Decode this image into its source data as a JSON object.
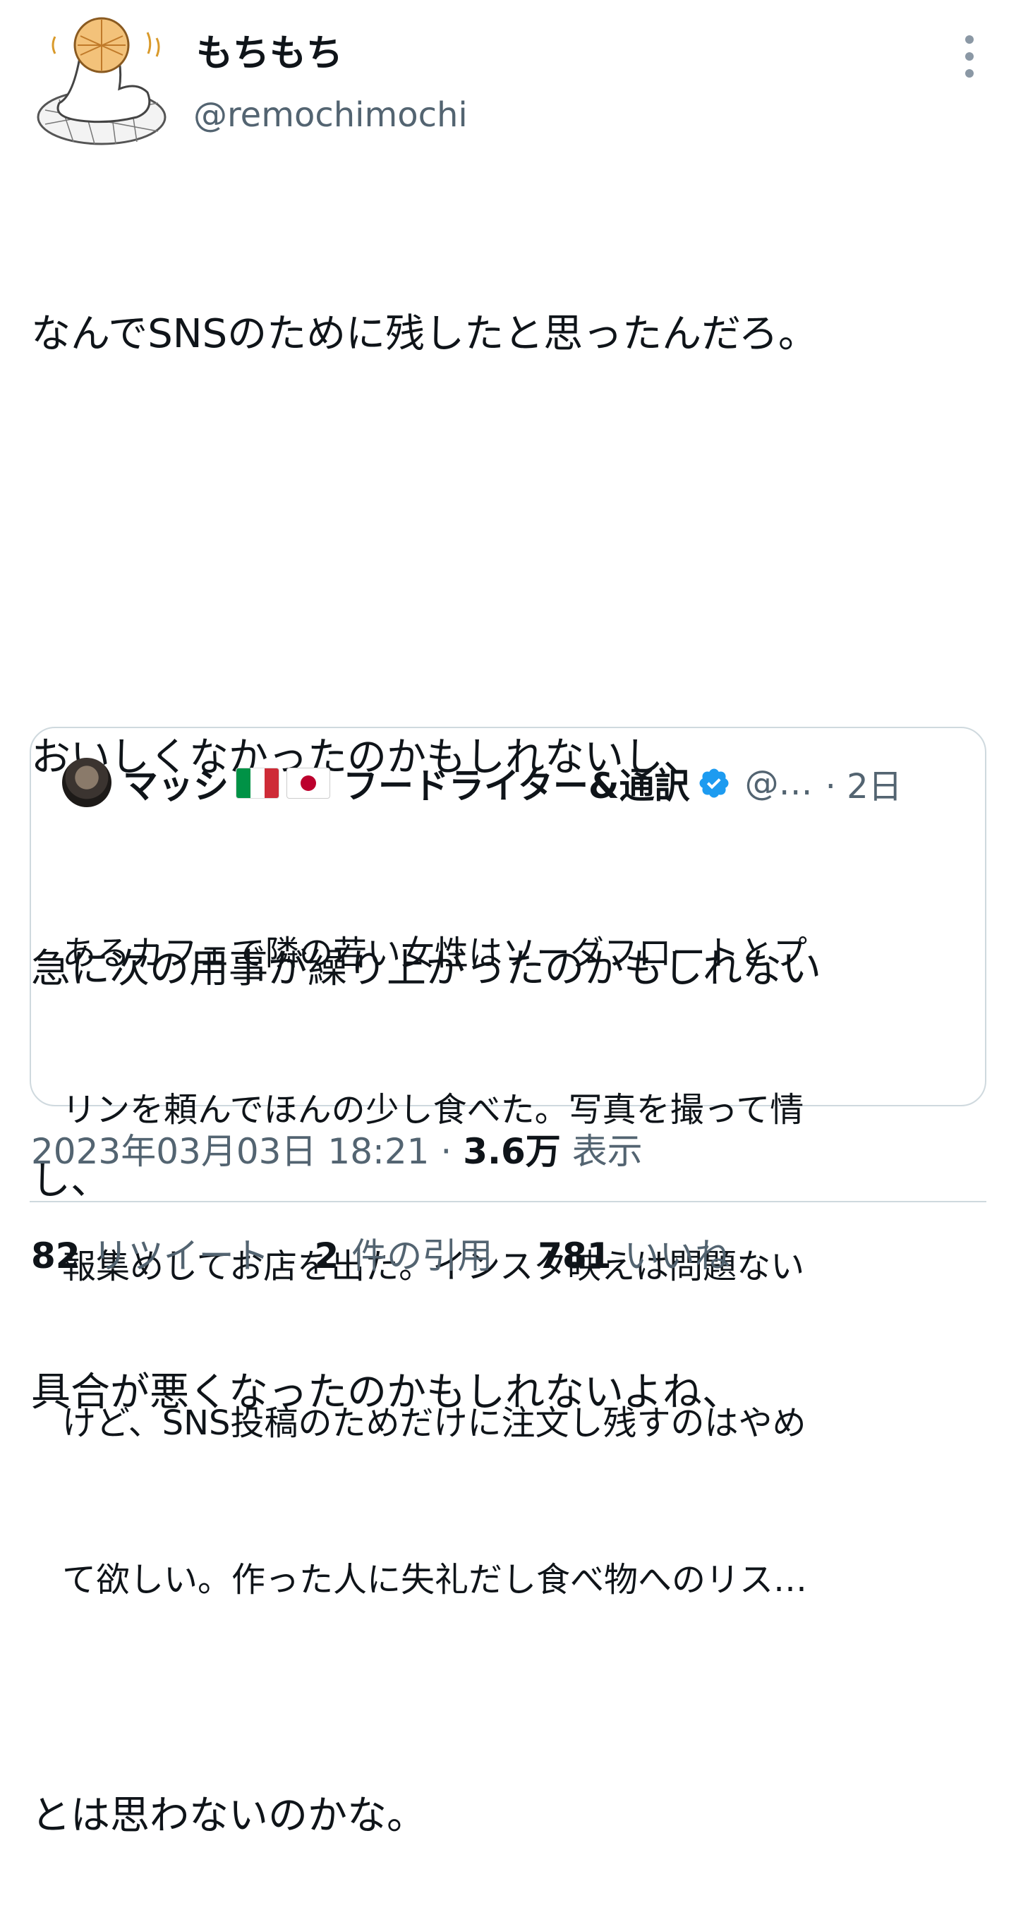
{
  "author": {
    "display_name": "もちもち",
    "handle": "@remochimochi"
  },
  "tweet": {
    "lines": [
      "なんでSNSのために残したと思ったんだろ。",
      "",
      "おいしくなかったのかもしれないし、",
      "急に次の用事が繰り上がったのかもしれない",
      "し、",
      "具合が悪くなったのかもしれないよね、",
      "",
      "とは思わないのかな。"
    ]
  },
  "quote": {
    "name_part1": "マッシ",
    "name_part2": "フードライター&通訳",
    "handle": "@…",
    "time": "· 2日",
    "lines": [
      "あるカフェで隣の若い女性はソーダフロートとプ",
      "リンを頼んでほんの少し食べた。写真を撮って情",
      "報集めしてお店を出た。インスタ映えは問題ない",
      "けど、SNS投稿のためだけに注文し残すのはやめ",
      "て欲しい。作った人に失礼だし食べ物へのリス…"
    ]
  },
  "meta": {
    "datetime": "2023年03月03日 18:21",
    "separator": "·",
    "views_count": "3.6万",
    "views_label": "表示"
  },
  "stats": {
    "retweets_count": "82",
    "retweets_label": "リツイート",
    "quotes_count": "2",
    "quotes_label": "件の引用",
    "likes_count": "781",
    "likes_label": "いいね"
  },
  "colors": {
    "text_primary": "#0f1419",
    "text_secondary": "#536471",
    "border": "#cfd9de",
    "verified_blue": "#1d9bf0"
  }
}
